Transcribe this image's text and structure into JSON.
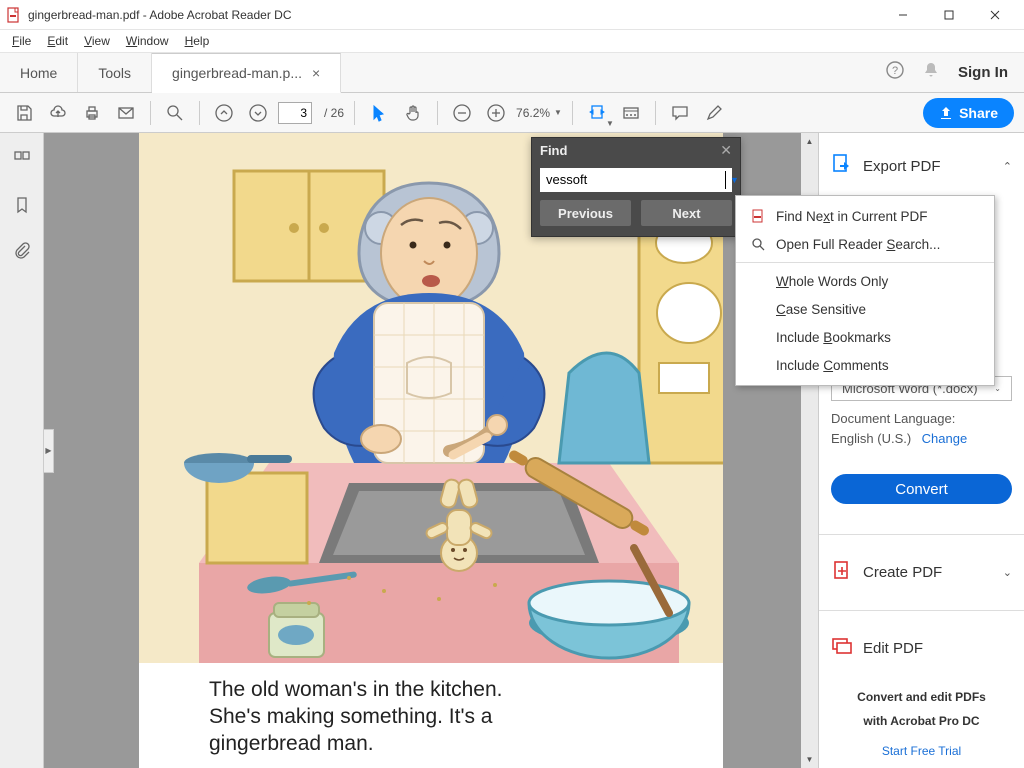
{
  "window": {
    "title": "gingerbread-man.pdf - Adobe Acrobat Reader DC"
  },
  "menubar": {
    "file": "File",
    "edit": "Edit",
    "view": "View",
    "window": "Window",
    "help": "Help"
  },
  "tabs": {
    "home": "Home",
    "tools": "Tools",
    "doc": "gingerbread-man.p...",
    "sign_in": "Sign In"
  },
  "toolbar": {
    "page_current": "3",
    "page_total": "/ 26",
    "zoom": "76.2%",
    "share": "Share"
  },
  "page_text": {
    "line1": "The old woman's in the kitchen.",
    "line2": "She's making something. It's a",
    "line3": "gingerbread man."
  },
  "find": {
    "title": "Find",
    "value": "vessoft",
    "prev": "Previous",
    "next": "Next"
  },
  "find_menu": {
    "next_in_pdf": "Find Next in Current PDF",
    "full_search": "Open Full Reader Search...",
    "whole_words": "Whole Words Only",
    "case_sensitive": "Case Sensitive",
    "bookmarks": "Include Bookmarks",
    "comments": "Include Comments"
  },
  "right_panel": {
    "export_title": "Export PDF",
    "format_sel": "Microsoft Word (*.docx)",
    "doclang_label": "Document Language:",
    "doclang_val": "English (U.S.)",
    "change": "Change",
    "convert": "Convert",
    "create_title": "Create PDF",
    "edit_title": "Edit PDF",
    "promo1": "Convert and edit PDFs",
    "promo2": "with Acrobat Pro DC",
    "trial": "Start Free Trial"
  }
}
